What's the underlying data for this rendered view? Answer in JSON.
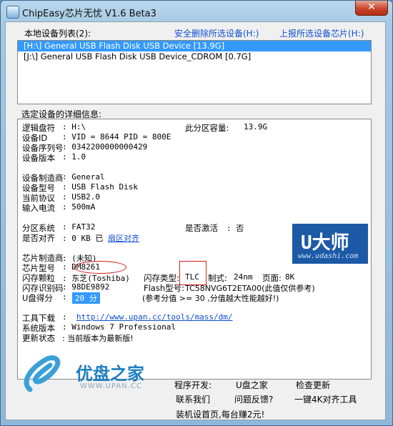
{
  "window": {
    "title": "ChipEasy芯片无忧 V1.6 Beta3",
    "close_label": "✕"
  },
  "top": {
    "device_list_label": "本地设备列表(2):",
    "safe_remove_link": "安全删除所选设备(H:)",
    "report_link": "上报所选设备芯片(H:)"
  },
  "devices": [
    "[H:\\] General USB Flash Disk USB Device [13.9G]",
    "[J:\\] General USB Flash Disk USB Device_CDROM [0.7G]"
  ],
  "detail_label": "选定设备的详细信息:",
  "details": {
    "drive_letter_k": "逻辑盘符",
    "drive_letter_v": ":  H:\\",
    "partition_capacity_k": "此分区容量:",
    "partition_capacity_v": "13.9G",
    "device_id_k": "设备ID",
    "device_id_v": ":  VID = 8644    PID = 800E",
    "serial_k": "设备序列号",
    "serial_v": ":  0342200000000429",
    "version_k": "设备版本",
    "version_v": ":  1.0",
    "vendor_k": "设备制造商",
    "vendor_v": ":  General",
    "model_k": "设备型号",
    "model_v": ":  USB Flash Disk",
    "protocol_k": "当前协议",
    "protocol_v": ":  USB2.0",
    "current_k": "输入电流",
    "current_v": ":  500mA",
    "fs_k": "分区系统",
    "fs_v": ":  FAT32",
    "active_k": "是否激活",
    "active_v": ":   否",
    "align_k": "是否对齐",
    "align_v": ":  0 KB 已",
    "align_link": "扇区对齐",
    "chip_vendor_k": "芯片制造商",
    "chip_vendor_v": ":  (未知)",
    "chip_model_k": "芯片型号",
    "chip_model_v": ":  DM8261",
    "flash_k": "闪存颗粒",
    "flash_v": ":  东芝(Toshiba)",
    "flash_type_k": "闪存类型:",
    "flash_type_v": "TLC",
    "process_k": "制式:",
    "process_v": "24nm",
    "page_k": "页面:",
    "page_v": "8K",
    "flash_id_k": "闪存识别码",
    "flash_id_v": ":  98DE9892",
    "flash_model_k": "Flash型号:",
    "flash_model_v": "TC58NVG6T2ETA00(此值仅供参考)",
    "score_k": "U盘得分",
    "score_v": "20 分",
    "score_note": "(参考分值 >= 30 ,分值越大性能越好!)",
    "tool_k": "工具下载",
    "tool_link": "http://www.upan.cc/tools/mass/dm/",
    "os_k": "系统版本",
    "os_v": ":  Windows 7 Professional",
    "update_k": "更新状态",
    "update_v": ":  当前版本为最新版!"
  },
  "badge": {
    "big": "U大师",
    "small": "www.udashi.com"
  },
  "bottom": {
    "logo_text": "优盘之家",
    "logo_sub": "WWW.UPAN.CC",
    "dev_label": "程序开发:",
    "upan_home": "U盘之家",
    "check_update": "检查更新",
    "contact": "联系我们",
    "feedback": "问题反馈?",
    "align_tool": "一键4K对齐工具",
    "homepage": "装机设首页,每台赚2元!"
  }
}
